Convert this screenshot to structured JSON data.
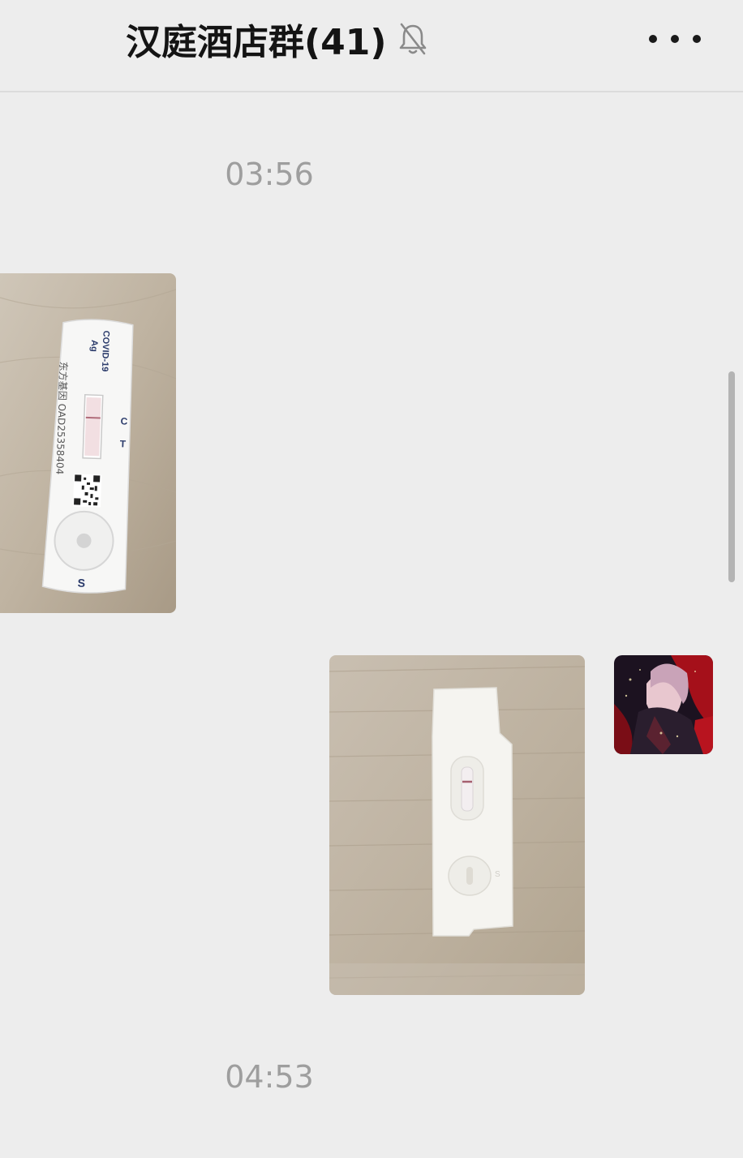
{
  "header": {
    "title": "汉庭酒店群(41)",
    "mute_icon": "bell-slash-icon",
    "more_icon": "more-dots-icon"
  },
  "messages": [
    {
      "type": "timestamp",
      "text": "03:56"
    },
    {
      "type": "image",
      "side": "left",
      "test_card": {
        "brand": "COVID-19",
        "sub": "Ag",
        "maker": "东方基因",
        "code": "OAD25358404",
        "c_label": "C",
        "t_label": "T",
        "s_label": "S"
      }
    },
    {
      "type": "image",
      "side": "right",
      "sender_avatar": "anime-avatar",
      "test_card": {
        "s_label": "S"
      }
    },
    {
      "type": "timestamp",
      "text": "04:53"
    }
  ],
  "colors": {
    "background": "#ededed",
    "timestamp": "#9e9e9e",
    "title": "#141414"
  }
}
